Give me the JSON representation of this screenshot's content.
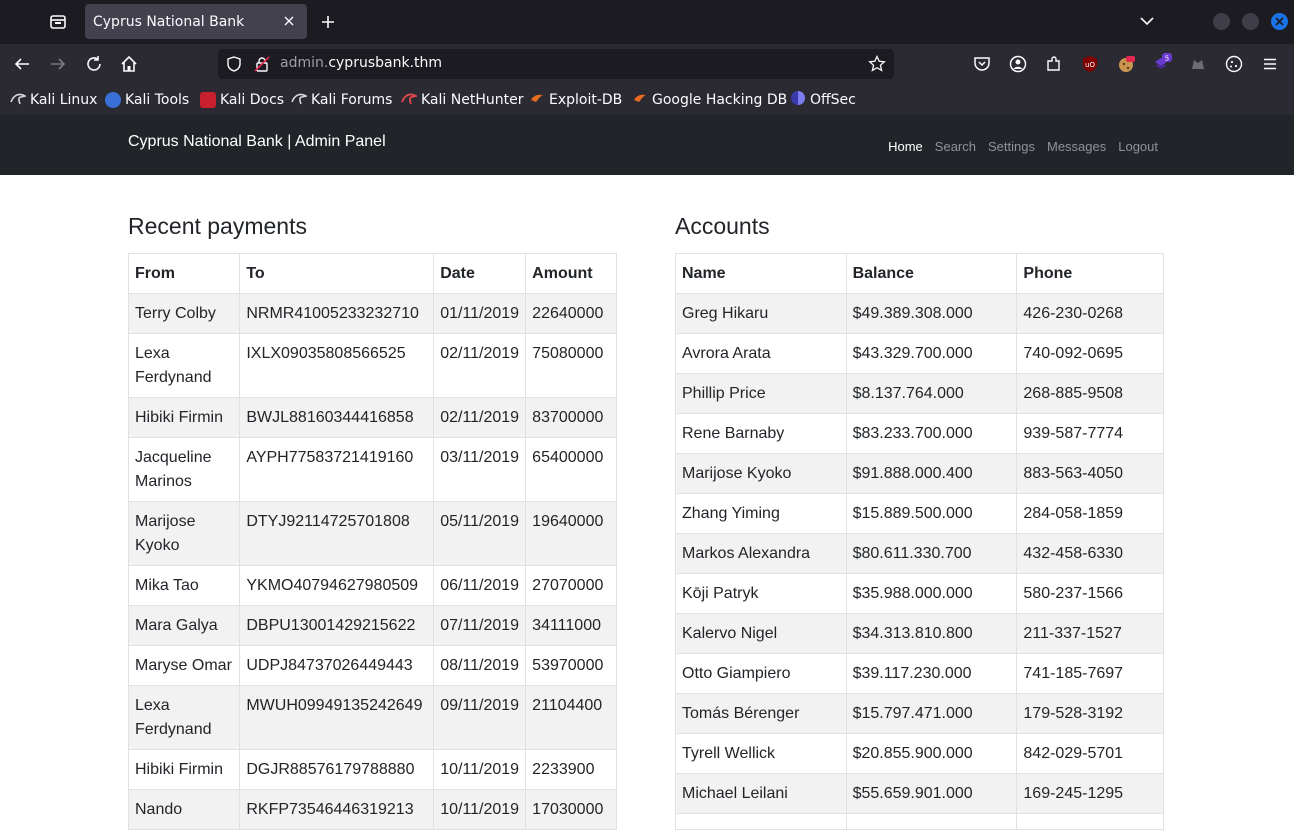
{
  "browser": {
    "tab_title": "Cyprus National Bank",
    "url_prefix": "admin.",
    "url_domain": "cyprusbank.thm",
    "extension_badge": "5",
    "bookmarks": [
      "Kali Linux",
      "Kali Tools",
      "Kali Docs",
      "Kali Forums",
      "Kali NetHunter",
      "Exploit-DB",
      "Google Hacking DB",
      "OffSec"
    ]
  },
  "site": {
    "brand": "Cyprus National Bank | Admin Panel",
    "nav": [
      "Home",
      "Search",
      "Settings",
      "Messages",
      "Logout"
    ]
  },
  "payments": {
    "title": "Recent payments",
    "columns": [
      "From",
      "To",
      "Date",
      "Amount"
    ],
    "rows": [
      [
        "Terry Colby",
        "NRMR41005233232710",
        "01/11/2019",
        "22640000"
      ],
      [
        "Lexa Ferdynand",
        "IXLX09035808566525",
        "02/11/2019",
        "75080000"
      ],
      [
        "Hibiki Firmin",
        "BWJL88160344416858",
        "02/11/2019",
        "83700000"
      ],
      [
        "Jacqueline Marinos",
        "AYPH77583721419160",
        "03/11/2019",
        "65400000"
      ],
      [
        "Marijose Kyoko",
        "DTYJ92114725701808",
        "05/11/2019",
        "19640000"
      ],
      [
        "Mika Tao",
        "YKMO40794627980509",
        "06/11/2019",
        "27070000"
      ],
      [
        "Mara Galya",
        "DBPU13001429215622",
        "07/11/2019",
        "34111000"
      ],
      [
        "Maryse Omar",
        "UDPJ84737026449443",
        "08/11/2019",
        "53970000"
      ],
      [
        "Lexa Ferdynand",
        "MWUH09949135242649",
        "09/11/2019",
        "21104400"
      ],
      [
        "Hibiki Firmin",
        "DGJR88576179788880",
        "10/11/2019",
        "2233900"
      ],
      [
        "Nando",
        "RKFP73546446319213",
        "10/11/2019",
        "17030000"
      ]
    ]
  },
  "accounts": {
    "title": "Accounts",
    "columns": [
      "Name",
      "Balance",
      "Phone"
    ],
    "rows": [
      [
        "Greg Hikaru",
        "$49.389.308.000",
        "426-230-0268"
      ],
      [
        "Avrora Arata",
        "$43.329.700.000",
        "740-092-0695"
      ],
      [
        "Phillip Price",
        "$8.137.764.000",
        "268-885-9508"
      ],
      [
        "Rene Barnaby",
        "$83.233.700.000",
        "939-587-7774"
      ],
      [
        "Marijose Kyoko",
        "$91.888.000.400",
        "883-563-4050"
      ],
      [
        "Zhang Yiming",
        "$15.889.500.000",
        "284-058-1859"
      ],
      [
        "Markos Alexandra",
        "$80.611.330.700",
        "432-458-6330"
      ],
      [
        "Kōji Patryk",
        "$35.988.000.000",
        "580-237-1566"
      ],
      [
        "Kalervo Nigel",
        "$34.313.810.800",
        "211-337-1527"
      ],
      [
        "Otto Giampiero",
        "$39.117.230.000",
        "741-185-7697"
      ],
      [
        "Tomás Bérenger",
        "$15.797.471.000",
        "179-528-3192"
      ],
      [
        "Tyrell Wellick",
        "$20.855.900.000",
        "842-029-5701"
      ],
      [
        "Michael Leilani",
        "$55.659.901.000",
        "169-245-1295"
      ],
      [
        "",
        "",
        ""
      ]
    ]
  }
}
